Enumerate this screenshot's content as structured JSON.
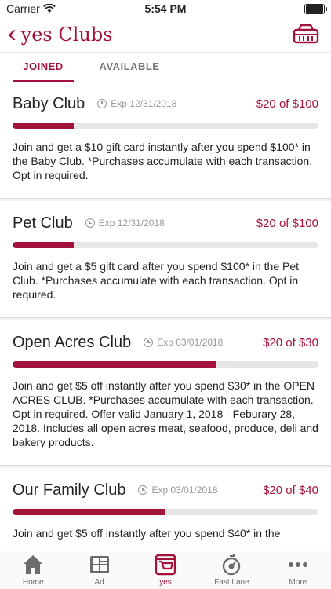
{
  "status_bar": {
    "carrier": "Carrier",
    "time": "5:54 PM"
  },
  "nav": {
    "back_label": "yes Clubs"
  },
  "tabs": [
    {
      "label": "JOINED",
      "active": true
    },
    {
      "label": "AVAILABLE",
      "active": false
    }
  ],
  "clubs": [
    {
      "name": "Baby Club",
      "expires": "Exp 12/31/2018",
      "progress_text": "$20 of $100",
      "progress": 0.2,
      "description": "Join and get a $10 gift card instantly after you spend $100* in the Baby Club. *Purchases accumulate with each transaction. Opt in required."
    },
    {
      "name": "Pet Club",
      "expires": "Exp 12/31/2018",
      "progress_text": "$20 of $100",
      "progress": 0.2,
      "description": "Join and get a $5 gift card after you spend $100* in the Pet Club. *Purchases accumulate with each transaction. Opt in required."
    },
    {
      "name": "Open Acres Club",
      "expires": "Exp 03/01/2018",
      "progress_text": "$20 of $30",
      "progress": 0.667,
      "description": "Join and get $5 off instantly after you spend $30* in the OPEN ACRES CLUB. *Purchases accumulate with each transaction. Opt in required. Offer valid January 1, 2018 - Feburary 28, 2018. Includes all open acres meat, seafood, produce, deli and bakery products."
    },
    {
      "name": "Our Family Club",
      "expires": "Exp 03/01/2018",
      "progress_text": "$20 of $40",
      "progress": 0.5,
      "description": "Join and get $5 off instantly after you spend $40* in the"
    }
  ],
  "tab_bar": [
    {
      "label": "Home",
      "icon": "home-icon",
      "active": false
    },
    {
      "label": "Ad",
      "icon": "ad-icon",
      "active": false
    },
    {
      "label": "yes",
      "icon": "yes-basket-icon",
      "active": true
    },
    {
      "label": "Fast Lane",
      "icon": "fast-lane-icon",
      "active": false
    },
    {
      "label": "More",
      "icon": "more-icon",
      "active": false
    }
  ],
  "colors": {
    "accent": "#a3123a",
    "progress_track": "#e6e6e6"
  }
}
